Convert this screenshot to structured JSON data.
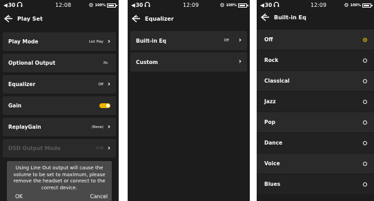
{
  "screens": [
    {
      "status": {
        "volume": "30",
        "time": "12:08",
        "battery": "100%"
      },
      "title": "Play Set",
      "rows": [
        {
          "label": "Play Mode",
          "value": "List Play"
        },
        {
          "label": "Optional Output",
          "value": "Po"
        },
        {
          "label": "Equalizer",
          "value": "Off"
        },
        {
          "label": "Gain",
          "value": ""
        },
        {
          "label": "ReplayGain",
          "value": "(None)"
        },
        {
          "label": "DSD Output Mode",
          "value": "PCM"
        }
      ],
      "dialog": {
        "message": "Using Line Out output will cause the volume to be set to maximum, please remove the headset or connect to the correct device.",
        "ok": "OK",
        "cancel": "Cancel"
      }
    },
    {
      "status": {
        "volume": "30",
        "time": "12:09",
        "battery": "100%"
      },
      "title": "Equalizer",
      "rows": [
        {
          "label": "Built-in Eq",
          "value": "Off"
        },
        {
          "label": "Custom",
          "value": ""
        }
      ]
    },
    {
      "status": {
        "volume": "30",
        "time": "12:09",
        "battery": "100%"
      },
      "title": "Built-in Eq",
      "options": [
        "Off",
        "Rock",
        "Classical",
        "Jazz",
        "Pop",
        "Dance",
        "Voice",
        "Blues"
      ],
      "selected": "Off"
    }
  ],
  "colors": {
    "accent": "#f2b200",
    "background": "#1c1c1c",
    "row": "#2a2a2a",
    "dialog": "#4a4a4a"
  }
}
